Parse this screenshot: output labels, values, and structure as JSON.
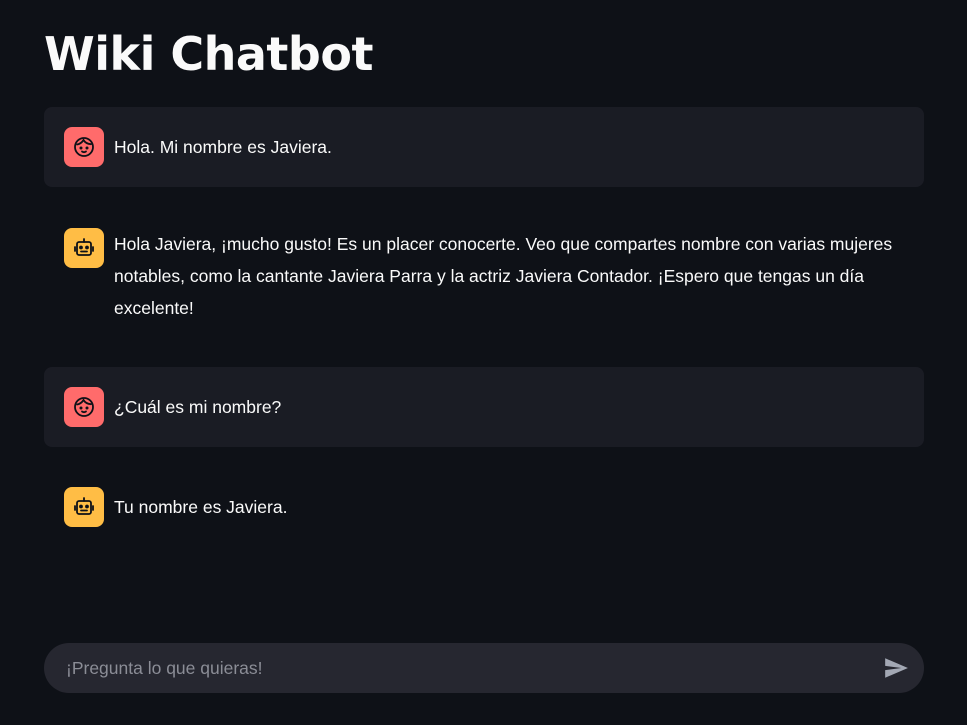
{
  "app": {
    "title": "Wiki Chatbot"
  },
  "messages": [
    {
      "role": "user",
      "avatar_icon": "face-icon",
      "text": "Hola. Mi nombre es Javiera."
    },
    {
      "role": "assistant",
      "avatar_icon": "robot-icon",
      "text": "Hola Javiera, ¡mucho gusto! Es un placer conocerte. Veo que compartes nombre con varias mujeres notables, como la cantante Javiera Parra y la actriz Javiera Contador. ¡Espero que tengas un día excelente!"
    },
    {
      "role": "user",
      "avatar_icon": "face-icon",
      "text": "¿Cuál es mi nombre?"
    },
    {
      "role": "assistant",
      "avatar_icon": "robot-icon",
      "text": "Tu nombre es Javiera."
    }
  ],
  "chat_input": {
    "placeholder": "¡Pregunta lo que quieras!",
    "value": "",
    "send_icon": "send-icon"
  },
  "colors": {
    "background": "#0e1117",
    "user_bubble": "#1a1c24",
    "user_avatar": "#ff6b6b",
    "assistant_avatar": "#ffbd45",
    "input_background": "#262730"
  }
}
